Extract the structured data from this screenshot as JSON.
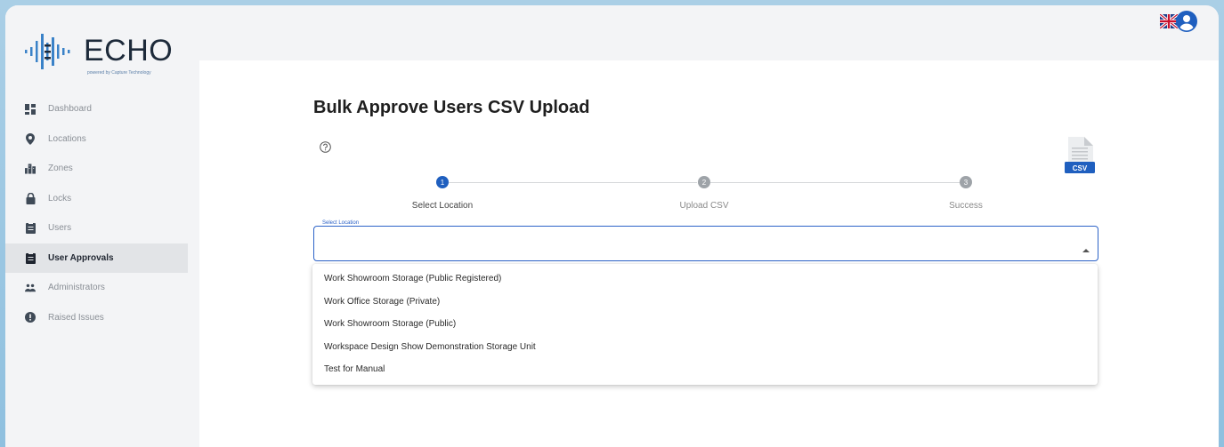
{
  "brand": {
    "name": "ECHO",
    "tagline": "powered by Capture Technology"
  },
  "sidebar": {
    "items": [
      {
        "label": "Dashboard",
        "icon": "dashboard-icon"
      },
      {
        "label": "Locations",
        "icon": "location-pin-icon"
      },
      {
        "label": "Zones",
        "icon": "buildings-icon"
      },
      {
        "label": "Locks",
        "icon": "lock-icon"
      },
      {
        "label": "Users",
        "icon": "clipboard-icon"
      },
      {
        "label": "User Approvals",
        "icon": "clipboard-icon",
        "active": true
      },
      {
        "label": "Administrators",
        "icon": "people-icon"
      },
      {
        "label": "Raised Issues",
        "icon": "alert-icon"
      }
    ]
  },
  "header": {
    "flag": "uk-flag-icon",
    "avatar": "user-avatar-icon"
  },
  "page": {
    "title": "Bulk Approve Users CSV Upload",
    "csv_badge": "CSV"
  },
  "stepper": {
    "steps": [
      {
        "number": "1",
        "label": "Select Location",
        "active": true
      },
      {
        "number": "2",
        "label": "Upload CSV",
        "active": false
      },
      {
        "number": "3",
        "label": "Success",
        "active": false
      }
    ]
  },
  "select": {
    "label": "Select Location",
    "value": "",
    "options": [
      "Work Showroom Storage (Public Registered)",
      "Work Office Storage (Private)",
      "Work Showroom Storage (Public)",
      "Workspace Design Show Demonstration Storage Unit",
      "Test for Manual"
    ]
  },
  "colors": {
    "accent": "#1f5fbf",
    "inactive_step": "#9ea3a8",
    "background": "#9ac7e2"
  }
}
